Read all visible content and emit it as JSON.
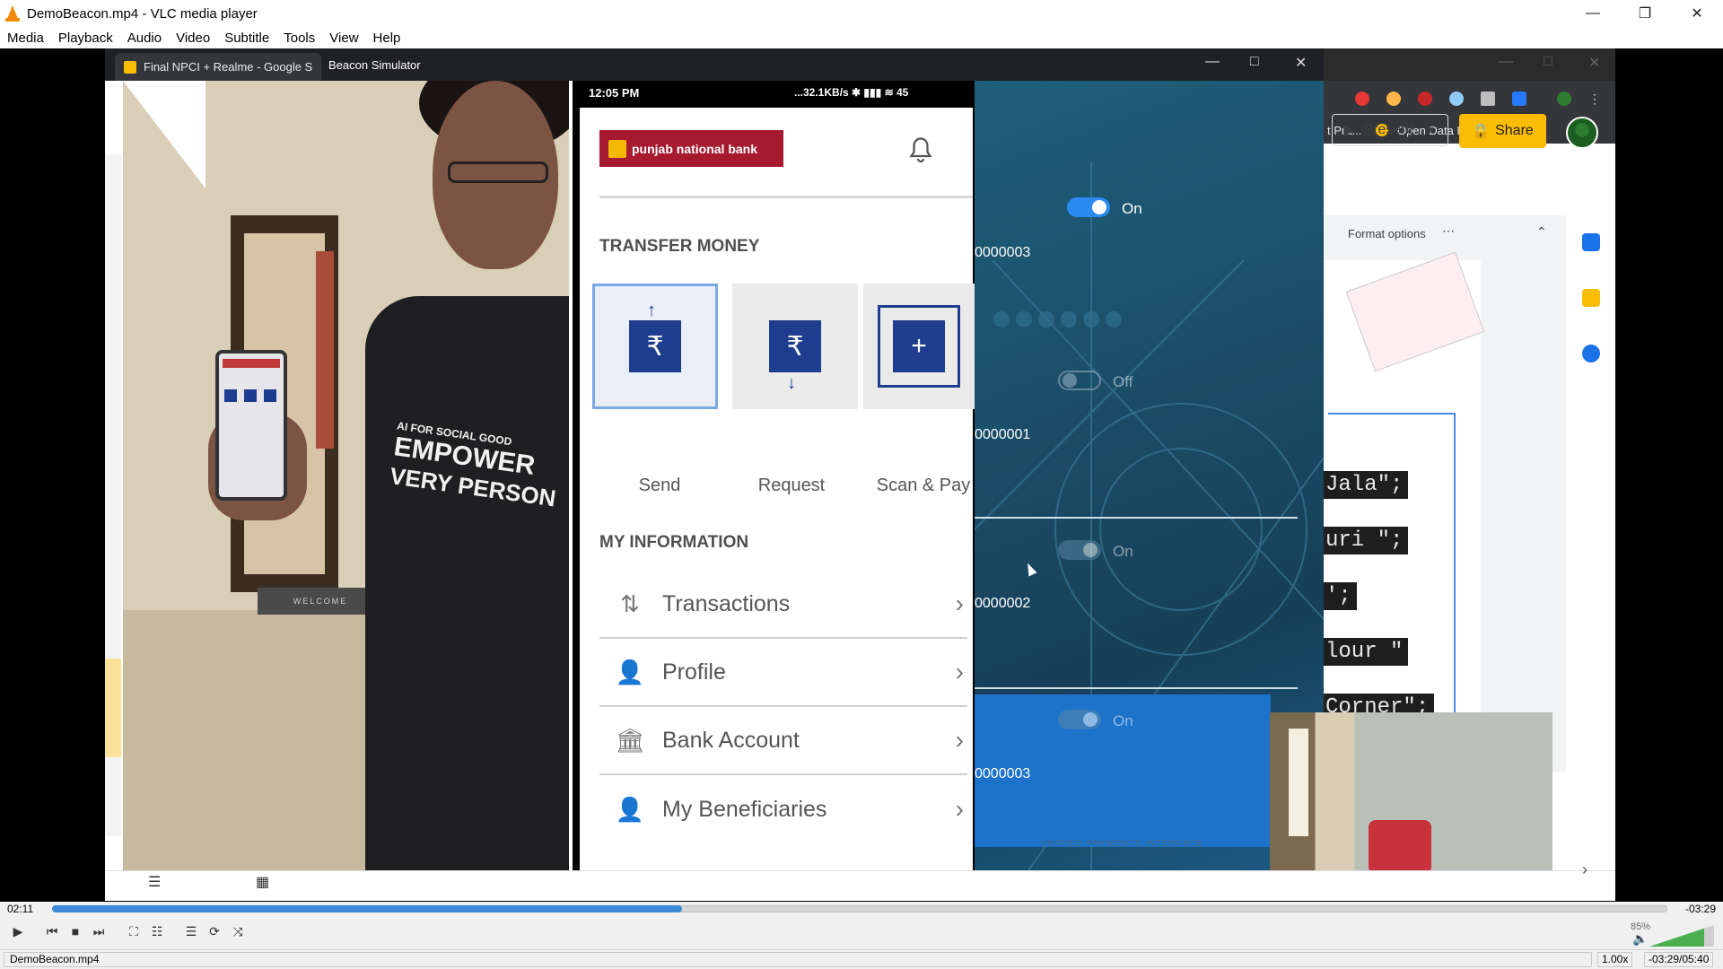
{
  "window": {
    "title": "DemoBeacon.mp4 - VLC media player",
    "minimize_icon": "minimize-icon",
    "maximize_icon": "restore-icon",
    "close_icon": "close-icon"
  },
  "menu": [
    "Media",
    "Playback",
    "Audio",
    "Video",
    "Subtitle",
    "Tools",
    "View",
    "Help"
  ],
  "video": {
    "browser_tab": "Final NPCI + Realme - Google S",
    "beacon_title": "Beacon Simulator",
    "bookmarks": [
      "t Pra...",
      "Open Data Kit - 201...",
      "»"
    ],
    "slides": {
      "present_label": "Present",
      "share_label": "Share",
      "format_options": "Format options",
      "code_lines": [
        "Jala\";",
        "uri \";",
        "';",
        "lour \"",
        "Corner\";"
      ]
    },
    "person": {
      "shirt_text_1": "AI FOR SOCIAL GOOD",
      "shirt_text_2": "EMPOWER",
      "shirt_text_3": "VERY PERSON",
      "mat_text": "WELCOME"
    },
    "phone": {
      "status_time": "12:05 PM",
      "status_right": "...32.1KB/s ✱ ▮▮▮ ≋ 45",
      "bank_name": "punjab national bank",
      "transfer_title": "TRANSFER MONEY",
      "tiles": [
        {
          "label": "Send",
          "glyph": "₹"
        },
        {
          "label": "Request",
          "glyph": "₹"
        },
        {
          "label": "Scan & Pay",
          "glyph": "+"
        }
      ],
      "info_title": "MY INFORMATION",
      "info_rows": [
        {
          "label": "Transactions",
          "icon": "transactions-icon",
          "glyph": "⇅"
        },
        {
          "label": "Profile",
          "icon": "profile-icon",
          "glyph": "👤"
        },
        {
          "label": "Bank Account",
          "icon": "bank-icon",
          "glyph": "🏛"
        },
        {
          "label": "My Beneficiaries",
          "icon": "beneficiaries-icon",
          "glyph": "👤"
        }
      ]
    },
    "beacon": {
      "toggles": [
        {
          "state": "On",
          "id": "0000003"
        },
        {
          "state": "Off",
          "id": "0000001"
        },
        {
          "state": "On",
          "id": "0000002"
        },
        {
          "state": "On",
          "id": "0000003"
        }
      ],
      "footer": "UNIFIED PAYMENTS INTERFACE"
    }
  },
  "player": {
    "elapsed": "02:11",
    "remaining": "-03:29",
    "progress": 0.39,
    "volume": "85%",
    "filename": "DemoBeacon.mp4",
    "rate": "1.00x",
    "time_display": "-03:29/05:40"
  },
  "colors": {
    "vlc_orange": "#f08a00",
    "seek_blue": "#3c8ad8",
    "pnb_red": "#a6192e",
    "tile_blue": "#1f3d8f",
    "toggle_blue": "#2a8cf0",
    "share_yellow": "#fbbc04"
  }
}
